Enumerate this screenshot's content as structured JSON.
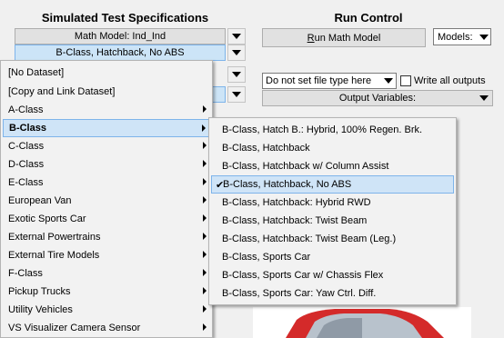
{
  "test_specs": {
    "heading": "Simulated Test Specifications",
    "math_model_label": "Math Model: Ind_Ind",
    "vehicle_label": "B-Class, Hatchback, No ABS"
  },
  "run_control": {
    "heading": "Run Control",
    "run_button_prefix": "R",
    "run_button_rest": "un Math Model",
    "models_label": "Models:",
    "file_type_value": "Do not set file type here",
    "write_all_label": "Write all outputs",
    "output_variables_label": "Output Variables:"
  },
  "dataset_menu": {
    "items": [
      {
        "label": "[No Dataset]",
        "submenu": false
      },
      {
        "label": "[Copy and Link Dataset]",
        "submenu": false
      },
      {
        "label": "A-Class",
        "submenu": true
      },
      {
        "label": "B-Class",
        "submenu": true,
        "selected": true
      },
      {
        "label": "C-Class",
        "submenu": true
      },
      {
        "label": "D-Class",
        "submenu": true
      },
      {
        "label": "E-Class",
        "submenu": true
      },
      {
        "label": "European Van",
        "submenu": true
      },
      {
        "label": "Exotic Sports Car",
        "submenu": true
      },
      {
        "label": "External Powertrains",
        "submenu": true
      },
      {
        "label": "External Tire Models",
        "submenu": true
      },
      {
        "label": "F-Class",
        "submenu": true
      },
      {
        "label": "Pickup Trucks",
        "submenu": true
      },
      {
        "label": "Utility Vehicles",
        "submenu": true
      },
      {
        "label": "VS Visualizer Camera Sensor",
        "submenu": true
      }
    ]
  },
  "bclass_submenu": {
    "items": [
      {
        "label": "B-Class, Hatch B.: Hybrid, 100% Regen. Brk."
      },
      {
        "label": "B-Class, Hatchback"
      },
      {
        "label": "B-Class, Hatchback w/ Column Assist"
      },
      {
        "label": "B-Class, Hatchback, No ABS",
        "checked": true
      },
      {
        "label": "B-Class, Hatchback: Hybrid RWD"
      },
      {
        "label": "B-Class, Hatchback: Twist Beam"
      },
      {
        "label": "B-Class, Hatchback: Twist Beam (Leg.)"
      },
      {
        "label": "B-Class, Sports Car"
      },
      {
        "label": "B-Class, Sports Car w/ Chassis Flex"
      },
      {
        "label": "B-Class, Sports Car: Yaw Ctrl. Diff."
      }
    ],
    "check_glyph": "✔"
  },
  "colors": {
    "selection_bg": "#cfe4f7",
    "selection_border": "#7eb4ea",
    "car_red": "#d42a2a"
  }
}
